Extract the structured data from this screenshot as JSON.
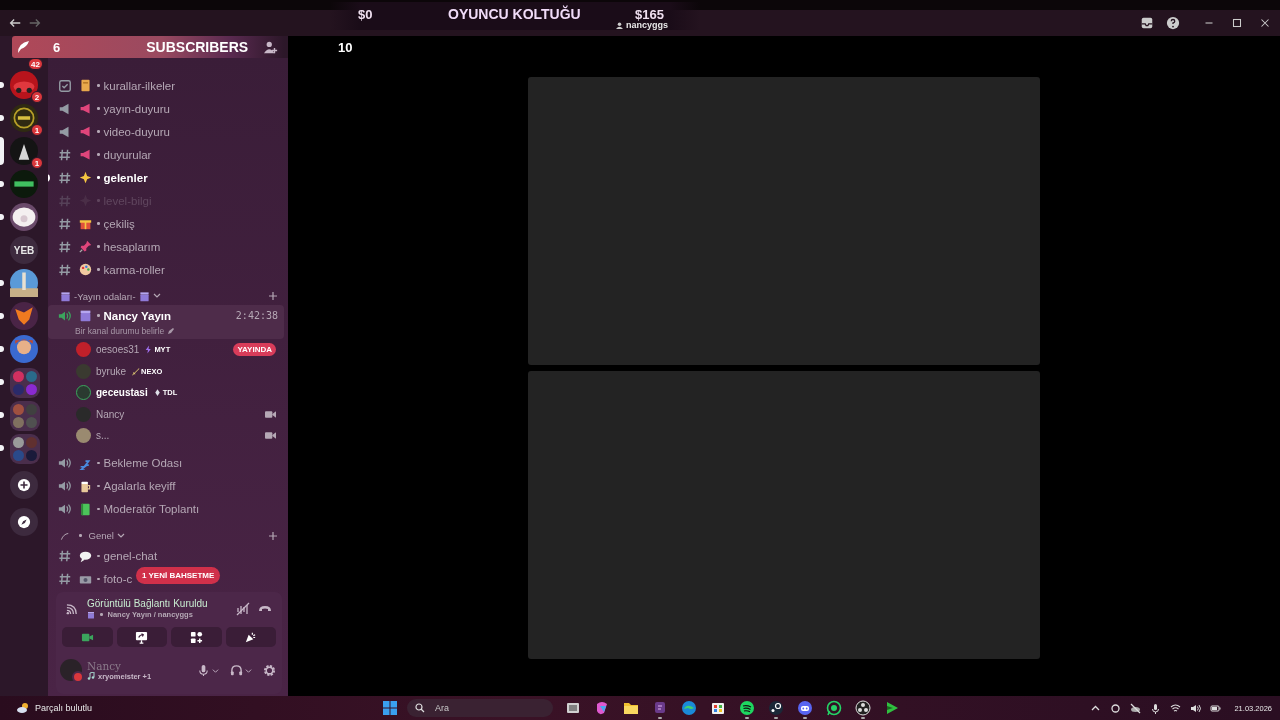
{
  "title_bar": {
    "stream_overlay": {
      "left_amount": "$0",
      "title": "OYUNCU KOLTUĞU",
      "right_amount": "$165",
      "user": "nancyggs"
    }
  },
  "subscriber_overlay": {
    "count": "6",
    "label": "SUBSCRIBERS",
    "goal": "10"
  },
  "servers": [
    {
      "kind": "covered",
      "badge": "42",
      "unread": false,
      "selected": false
    },
    {
      "kind": "image",
      "badge": "2",
      "unread": true,
      "selected": false
    },
    {
      "kind": "image",
      "badge": "1",
      "unread": true,
      "selected": false
    },
    {
      "kind": "image",
      "badge": "1",
      "unread": false,
      "selected": true
    },
    {
      "kind": "image",
      "unread": true,
      "selected": false
    },
    {
      "kind": "image",
      "unread": true,
      "selected": false
    },
    {
      "kind": "text",
      "label": "YEB",
      "unread": false,
      "selected": false
    },
    {
      "kind": "image",
      "unread": true,
      "selected": false
    },
    {
      "kind": "image",
      "unread": true,
      "selected": false
    },
    {
      "kind": "image",
      "unread": true,
      "selected": false
    },
    {
      "kind": "folder",
      "unread": true,
      "selected": false
    },
    {
      "kind": "folder",
      "unread": true,
      "selected": false
    },
    {
      "kind": "folder",
      "unread": true,
      "selected": false
    }
  ],
  "top_channels": [
    {
      "kind": "rules",
      "name": "kurallar-ilkeler",
      "unread": false,
      "muted": false
    },
    {
      "kind": "announcement",
      "name": "yayın-duyuru",
      "unread": false,
      "muted": false
    },
    {
      "kind": "announcement",
      "name": "video-duyuru",
      "unread": false,
      "muted": false
    },
    {
      "kind": "text",
      "name": "duyurular",
      "unread": false,
      "muted": false
    },
    {
      "kind": "text",
      "name": "gelenler",
      "unread": true,
      "muted": false
    },
    {
      "kind": "text",
      "name": "level-bilgi",
      "unread": false,
      "muted": true
    },
    {
      "kind": "text",
      "name": "çekiliş",
      "unread": false,
      "muted": false
    },
    {
      "kind": "text",
      "name": "hesaplarım",
      "unread": false,
      "muted": false
    },
    {
      "kind": "text",
      "name": "karma-roller",
      "unread": false,
      "muted": false
    }
  ],
  "categories": [
    {
      "name": "-Yayın odaları-",
      "expanded": true,
      "channels": [
        {
          "kind": "voice",
          "name": "Nancy Yayın",
          "connected": true,
          "timer": "2:42:38",
          "status": "Bir kanal durumu belirle",
          "unread": false,
          "muted": false,
          "members": [
            {
              "name": "oesoes31",
              "tag": "MYT",
              "badge": "YAYINDA",
              "speaking": false,
              "video": false
            },
            {
              "name": "byruke",
              "tag": "NEXO",
              "speaking": false,
              "video": false
            },
            {
              "name": "geceustasi",
              "tag": "TDL",
              "speaking": true,
              "video": false
            },
            {
              "name": "Nancy",
              "speaking": false,
              "video": true
            },
            {
              "name": "s...",
              "speaking": false,
              "video": true
            }
          ]
        },
        {
          "kind": "voice",
          "name": "Bekleme Odası",
          "connected": false,
          "unread": false,
          "muted": false
        },
        {
          "kind": "voice",
          "name": "Agalarla keyiff",
          "connected": false,
          "unread": false,
          "muted": false
        },
        {
          "kind": "voice",
          "name": "Moderatör Toplantı",
          "connected": false,
          "unread": false,
          "muted": false
        }
      ]
    },
    {
      "name": "Genel",
      "expanded": true,
      "channels": [
        {
          "kind": "text",
          "name": "genel-chat",
          "connected": false,
          "unread": false,
          "muted": false
        },
        {
          "kind": "text",
          "name": "foto-c",
          "connected": false,
          "unread": false,
          "muted": false
        }
      ]
    }
  ],
  "mention_notice": "1 YENİ BAHSETME",
  "voice_panel": {
    "status": "Görüntülü Bağlantı Kuruldu",
    "location": "Nancy Yayın / nancyggs",
    "camera_on": true
  },
  "user_panel": {
    "name": "Nancy",
    "activity": "xryomeister +1",
    "do_not_disturb": true
  },
  "video_tiles": [
    {
      "kind": "empty"
    },
    {
      "kind": "empty"
    }
  ],
  "taskbar": {
    "weather": "Parçalı bulutlu",
    "search_placeholder": "Ara",
    "date": "21.03.2026",
    "apps": [
      {
        "running": false
      },
      {
        "running": false
      },
      {
        "running": false
      },
      {
        "running": true
      },
      {
        "running": false
      },
      {
        "running": false
      },
      {
        "running": true
      },
      {
        "running": true
      },
      {
        "running": true
      },
      {
        "running": false
      },
      {
        "running": true
      },
      {
        "running": false
      }
    ]
  }
}
